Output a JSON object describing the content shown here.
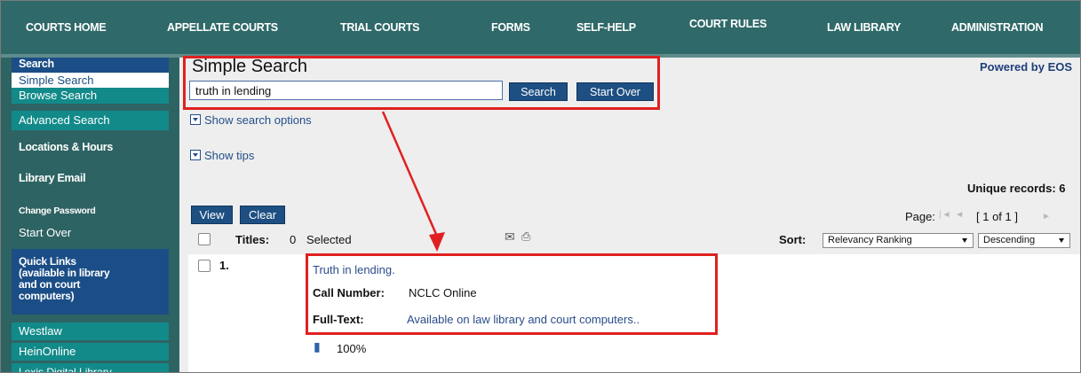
{
  "nav": {
    "items": [
      "COURTS HOME",
      "APPELLATE COURTS",
      "TRIAL COURTS",
      "FORMS",
      "SELF-HELP",
      "COURT RULES",
      "LAW LIBRARY",
      "ADMINISTRATION"
    ]
  },
  "sidebar": {
    "search_header": "Search",
    "simple_search": "Simple Search",
    "browse_search": "Browse Search",
    "advanced_search": "Advanced Search",
    "locations": "Locations & Hours",
    "library_email": "Library Email",
    "change_password": "Change Password",
    "start_over": "Start Over",
    "quick_links": [
      "Quick Links",
      "(available in library",
      "and on court",
      "computers)"
    ],
    "westlaw": "Westlaw",
    "heinonline": "HeinOnline",
    "lexis": "Lexis Digital Library"
  },
  "search": {
    "title": "Simple Search",
    "query": "truth in lending",
    "search_button": "Search",
    "start_over_button": "Start Over",
    "show_options": "Show search options",
    "show_tips": "Show tips",
    "powered_by": "Powered by EOS"
  },
  "results": {
    "unique_records": "Unique records: 6",
    "view_button": "View",
    "clear_button": "Clear",
    "page_label": "Page:",
    "page_indicator": "[ 1 of 1 ]",
    "titles_label": "Titles:",
    "selected_count": "0",
    "selected_label": "Selected",
    "sort_label": "Sort:",
    "sort_value": "Relevancy Ranking",
    "order_value": "Descending",
    "records": [
      {
        "number": "1.",
        "title": "Truth in lending.",
        "call_number_label": "Call Number:",
        "call_number": "NCLC Online",
        "fulltext_label": "Full-Text:",
        "fulltext_link": "Available on law library and court computers..",
        "relevance": "100%"
      }
    ]
  },
  "colors": {
    "nav_bg": "#306969",
    "sidebar_dark_blue": "#1b4e86",
    "sidebar_teal": "#138a8a",
    "button_blue": "#1e4f82",
    "highlight_red": "#e02020"
  }
}
